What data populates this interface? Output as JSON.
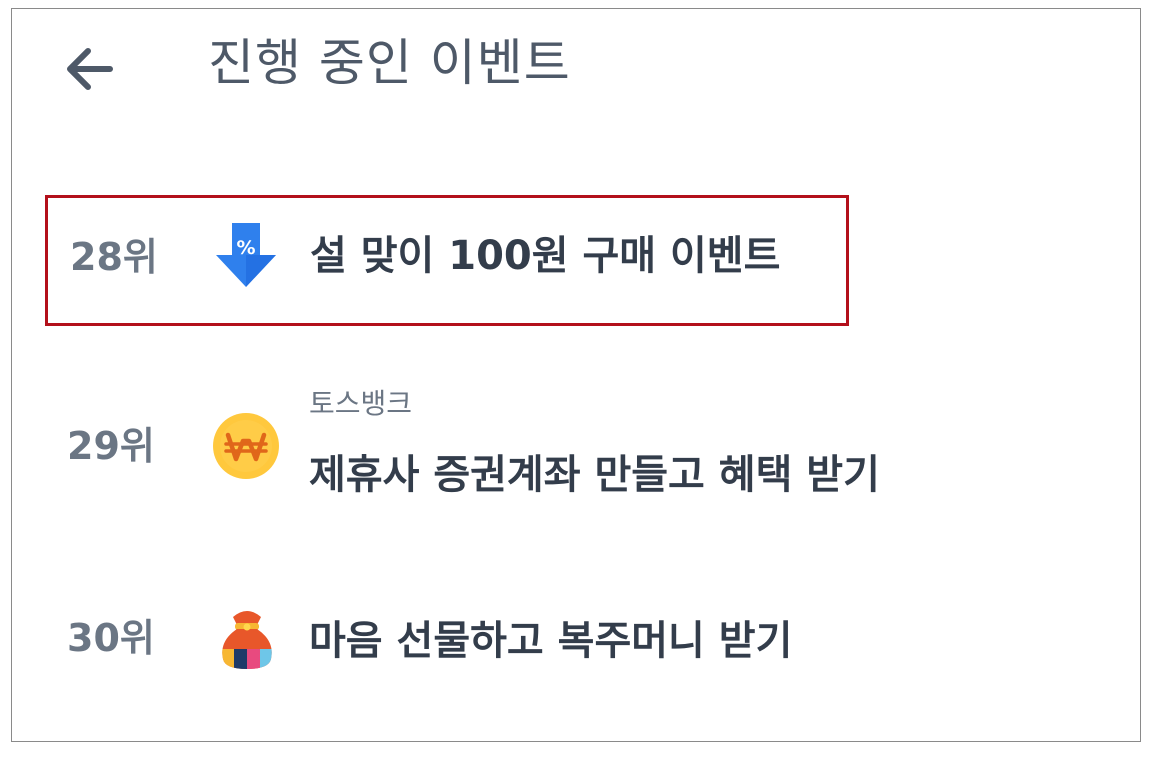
{
  "header": {
    "back_icon": "arrow-left-icon",
    "title": "진행 중인 이벤트"
  },
  "events": [
    {
      "rank": "28위",
      "icon": "discount-arrow-icon",
      "subtitle": "",
      "title": "설 맞이 100원 구매 이벤트",
      "highlighted": true
    },
    {
      "rank": "29위",
      "icon": "won-coin-icon",
      "subtitle": "토스뱅크",
      "title": "제휴사 증권계좌 만들고 혜택 받기",
      "highlighted": false
    },
    {
      "rank": "30위",
      "icon": "lucky-pouch-icon",
      "subtitle": "",
      "title": "마음 선물하고 복주머니 받기",
      "highlighted": false
    }
  ],
  "colors": {
    "highlight_border": "#b3101b",
    "title_text": "#333d4b",
    "rank_text": "#6b7684",
    "header_text": "#4e5968",
    "discount_blue": "#2f80ed",
    "coin_yellow": "#ffc83d"
  }
}
